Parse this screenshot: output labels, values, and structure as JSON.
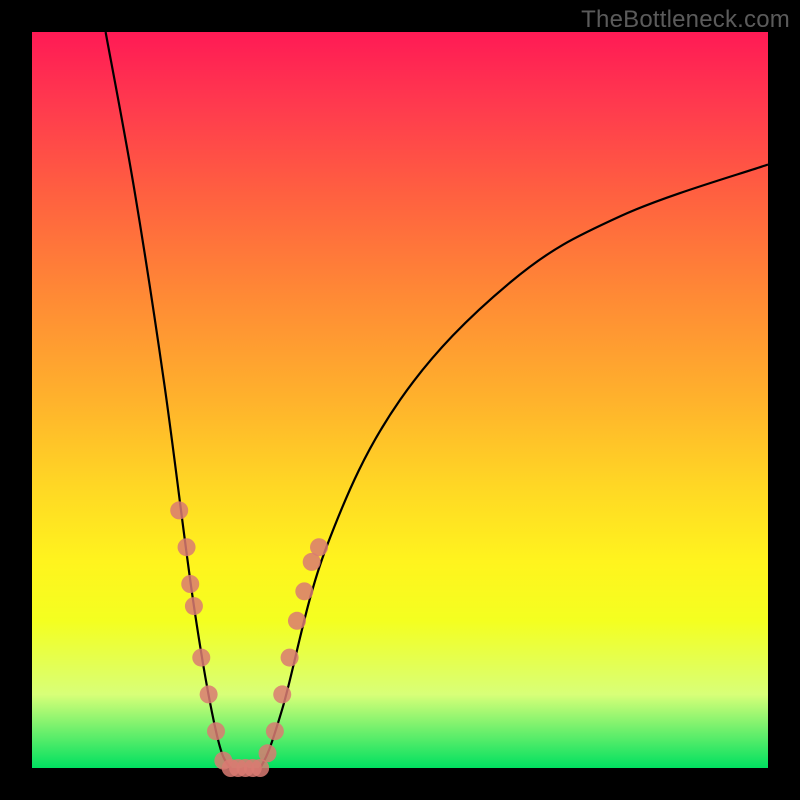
{
  "watermark_text": "TheBottleneck.com",
  "chart_data": {
    "type": "line",
    "title": "",
    "xlabel": "",
    "ylabel": "",
    "xlim": [
      0,
      100
    ],
    "ylim": [
      0,
      100
    ],
    "curve": {
      "description": "V-shaped bottleneck curve: high y-value (bad/red) far from optimal x, dipping to 0 (good/green) near x≈28.",
      "points": [
        {
          "x": 10,
          "y": 100
        },
        {
          "x": 14,
          "y": 78
        },
        {
          "x": 18,
          "y": 52
        },
        {
          "x": 22,
          "y": 22
        },
        {
          "x": 25,
          "y": 5
        },
        {
          "x": 27,
          "y": 0
        },
        {
          "x": 29,
          "y": 0
        },
        {
          "x": 31,
          "y": 0
        },
        {
          "x": 34,
          "y": 8
        },
        {
          "x": 40,
          "y": 30
        },
        {
          "x": 50,
          "y": 50
        },
        {
          "x": 65,
          "y": 66
        },
        {
          "x": 80,
          "y": 75
        },
        {
          "x": 100,
          "y": 82
        }
      ]
    },
    "series": [
      {
        "name": "sample-points",
        "color": "#d97a72",
        "values": [
          {
            "x": 20,
            "y": 35
          },
          {
            "x": 21,
            "y": 30
          },
          {
            "x": 21.5,
            "y": 25
          },
          {
            "x": 22,
            "y": 22
          },
          {
            "x": 23,
            "y": 15
          },
          {
            "x": 24,
            "y": 10
          },
          {
            "x": 25,
            "y": 5
          },
          {
            "x": 26,
            "y": 1
          },
          {
            "x": 27,
            "y": 0
          },
          {
            "x": 28,
            "y": 0
          },
          {
            "x": 29,
            "y": 0
          },
          {
            "x": 30,
            "y": 0
          },
          {
            "x": 31,
            "y": 0
          },
          {
            "x": 32,
            "y": 2
          },
          {
            "x": 33,
            "y": 5
          },
          {
            "x": 34,
            "y": 10
          },
          {
            "x": 35,
            "y": 15
          },
          {
            "x": 36,
            "y": 20
          },
          {
            "x": 37,
            "y": 24
          },
          {
            "x": 38,
            "y": 28
          },
          {
            "x": 39,
            "y": 30
          }
        ]
      }
    ],
    "gradient_stops": [
      {
        "pos": 0,
        "color": "#ff1a55"
      },
      {
        "pos": 100,
        "color": "#00e060"
      }
    ]
  }
}
